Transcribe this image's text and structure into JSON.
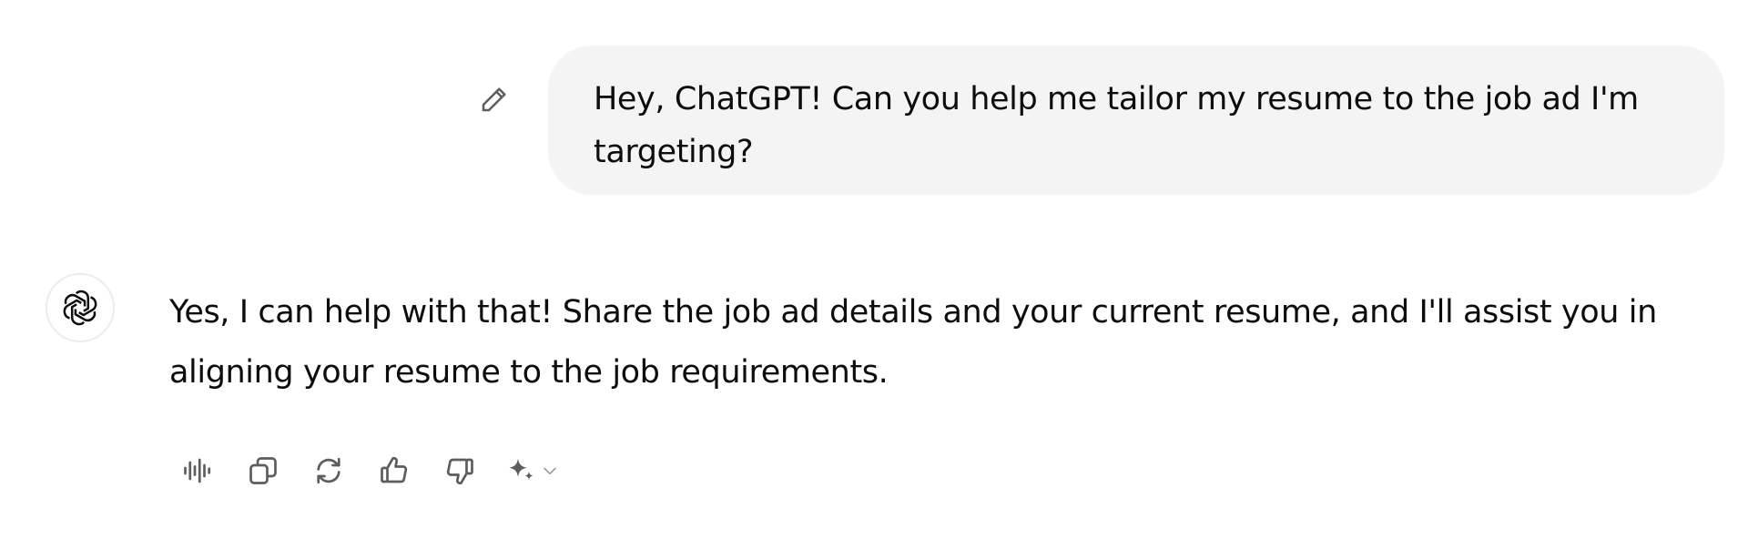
{
  "user_message": {
    "text": "Hey, ChatGPT! Can you help me tailor my resume to the job ad I'm targeting?",
    "edit_icon": "pencil-icon"
  },
  "assistant_message": {
    "avatar_icon": "openai-logo-icon",
    "text": "Yes, I can help with that! Share the job ad details and your current resume, and I'll assist you in aligning your resume to the job requirements."
  },
  "actions": [
    {
      "icon": "read-aloud-icon"
    },
    {
      "icon": "copy-icon"
    },
    {
      "icon": "regenerate-icon"
    },
    {
      "icon": "thumbs-up-icon"
    },
    {
      "icon": "thumbs-down-icon"
    },
    {
      "icon": "sparkle-icon"
    }
  ],
  "colors": {
    "bubble_bg": "#f4f4f4",
    "text": "#0d0d0d",
    "icon": "#5d5d5d"
  }
}
